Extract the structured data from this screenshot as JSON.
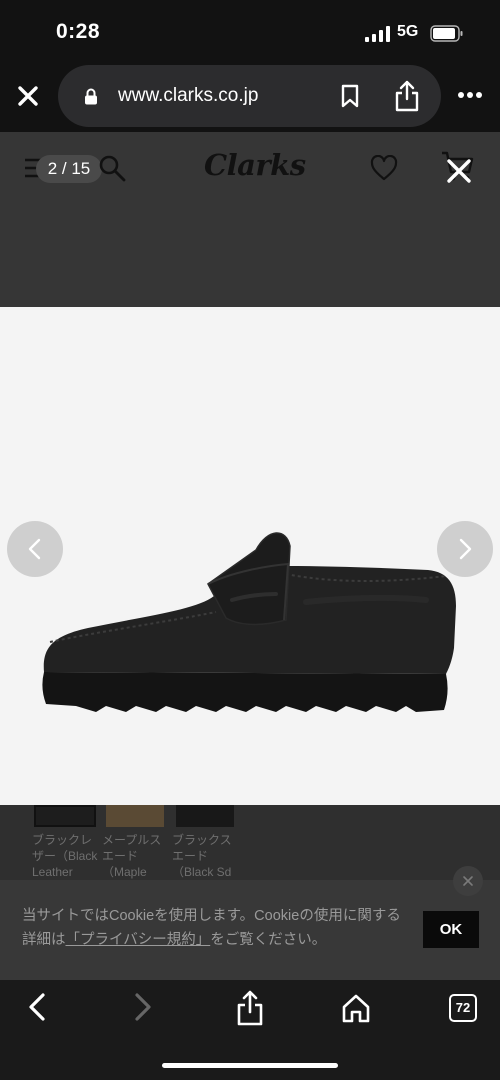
{
  "status_bar": {
    "time": "0:28",
    "network": "5G"
  },
  "browser": {
    "url": "www.clarks.co.jp",
    "tab_count": "72",
    "icons": [
      "close-icon",
      "lock-icon",
      "bookmark-icon",
      "share-icon",
      "more-icon",
      "back-icon",
      "forward-icon",
      "home-icon",
      "tabs-icon"
    ]
  },
  "site_header": {
    "logo": "Clarks",
    "gallery_counter": "2 / 15",
    "icons": [
      "menu-icon",
      "search-icon",
      "heart-icon",
      "cart-icon",
      "close-icon"
    ]
  },
  "swatches": [
    {
      "label": "ブラックレザー（Black Leather"
    },
    {
      "label": "メープルスエード（Maple Suede"
    },
    {
      "label": "ブラックスエード（Black Sd"
    }
  ],
  "cookie_banner": {
    "text_before": "当サイトではCookieを使用します。Cookieの使用に関する詳細は",
    "link": "「プライバシー規約」",
    "text_after": "をご覧ください。",
    "ok_label": "OK"
  },
  "colors": {
    "accent": "#000000",
    "banner_bg": "#383838",
    "photo_bg": "#f4f4f4"
  }
}
